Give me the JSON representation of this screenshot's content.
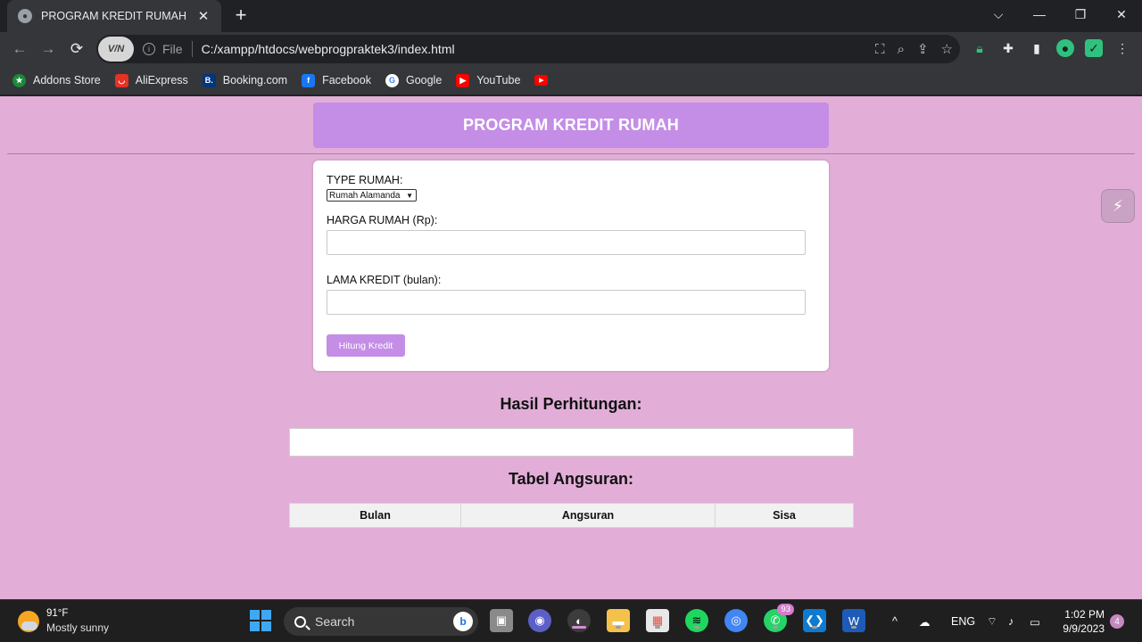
{
  "browser": {
    "tab_title": "PROGRAM KREDIT RUMAH",
    "tab_close": "✕",
    "newtab": "+",
    "scheme": "File",
    "url": "C:/xampp/htdocs/webprogpraktek3/index.html",
    "vpn_label": "V/N",
    "window_controls": {
      "dropdown": "⌵",
      "minimize": "—",
      "restore": "❐",
      "close": "✕"
    },
    "bookmarks": [
      {
        "label": "Addons Store",
        "icon": "addons-icon",
        "color": "#1a8a3a"
      },
      {
        "label": "AliExpress",
        "icon": "aliexpress-icon",
        "color": "#e43225"
      },
      {
        "label": "Booking.com",
        "icon": "booking-icon",
        "color": "#003580"
      },
      {
        "label": "Facebook",
        "icon": "facebook-icon",
        "color": "#1877f2"
      },
      {
        "label": "Google",
        "icon": "google-icon",
        "color": "#ffffff"
      },
      {
        "label": "YouTube",
        "icon": "youtube-icon",
        "color": "#ff0000"
      }
    ]
  },
  "page": {
    "header_title": "PROGRAM KREDIT RUMAH",
    "form": {
      "type_label": "TYPE RUMAH:",
      "type_selected": "Rumah Alamanda",
      "harga_label": "HARGA RUMAH (Rp):",
      "harga_value": "",
      "lama_label": "LAMA KREDIT (bulan):",
      "lama_value": "",
      "submit_label": "Hitung Kredit"
    },
    "hasil_title": "Hasil Perhitungan:",
    "tabel_title": "Tabel Angsuran:",
    "table_headers": [
      "Bulan",
      "Angsuran",
      "Sisa"
    ],
    "colors": {
      "background": "#e2aed8",
      "accent": "#c48de6"
    }
  },
  "taskbar": {
    "weather_temp": "91°F",
    "weather_cond": "Mostly sunny",
    "search_placeholder": "Search",
    "whatsapp_badge": "93",
    "language": "ENG",
    "time": "1:02 PM",
    "date": "9/9/2023",
    "notifications": "4"
  }
}
